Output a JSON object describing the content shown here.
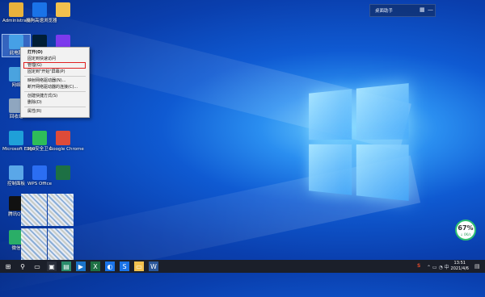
{
  "desktop": {
    "icons": [
      {
        "label": "Administrator",
        "icon": "user-folder-icon",
        "color": "#e8b23c"
      },
      {
        "label": "搜狗高速浏览器",
        "icon": "sogou-browser-icon",
        "color": "#1a73e8"
      },
      {
        "label": "",
        "icon": "folder-icon",
        "color": "#f2c14e"
      },
      {
        "label": "此电脑",
        "icon": "this-pc-icon",
        "color": "#46a0e6"
      },
      {
        "label": "",
        "icon": "photoshop-icon",
        "color": "#001e36"
      },
      {
        "label": "",
        "icon": "app-icon",
        "color": "#7c3aed"
      },
      {
        "label": "网络",
        "icon": "network-icon",
        "color": "#4aa3df"
      },
      {
        "label": "回收站",
        "icon": "recycle-bin-icon",
        "color": "#8fa6bf"
      },
      {
        "label": "Microsoft Edge",
        "icon": "edge-icon",
        "color": "#1fa0d8"
      },
      {
        "label": "360安全卫士",
        "icon": "security-app-icon",
        "color": "#2ebd59"
      },
      {
        "label": "Google Chrome",
        "icon": "chrome-icon",
        "color": "#dd4b39"
      },
      {
        "label": "控制面板",
        "icon": "control-panel-icon",
        "color": "#5aa7e8"
      },
      {
        "label": "WPS Office",
        "icon": "wps-icon",
        "color": "#2b6ef2"
      },
      {
        "label": "",
        "icon": "excel-icon",
        "color": "#1d7044"
      },
      {
        "label": "腾讯QQ",
        "icon": "qq-icon",
        "color": "#111111"
      },
      {
        "label": "微信",
        "icon": "wechat-icon",
        "color": "#2aae67"
      }
    ]
  },
  "context_menu": {
    "items": [
      {
        "label": "打开(O)",
        "bold": true
      },
      {
        "label": "固定到快速访问"
      },
      {
        "label": "管理(G)",
        "highlighted": true
      },
      {
        "label": "固定到\"开始\"屏幕(P)"
      },
      {
        "sep": true
      },
      {
        "label": "映射网络驱动器(N)..."
      },
      {
        "label": "断开网络驱动器的连接(C)..."
      },
      {
        "sep": true
      },
      {
        "label": "创建快捷方式(S)"
      },
      {
        "label": "删除(D)"
      },
      {
        "sep": true
      },
      {
        "label": "属性(R)"
      }
    ]
  },
  "widget": {
    "title": "桌面助手",
    "grid_symbol": "▦",
    "minimize_symbol": "—"
  },
  "net_meter": {
    "percent": "67%",
    "speed": "↓ 0K/s"
  },
  "taskbar": {
    "start_symbol": "⊞",
    "search_symbol": "⚲",
    "taskview_symbol": "▭",
    "apps": [
      {
        "icon": "terminal-icon",
        "color": "#2a2f3b",
        "char": "▣"
      },
      {
        "icon": "photos-icon",
        "color": "#2a8b6b",
        "char": "▤"
      },
      {
        "icon": "media-icon",
        "color": "#1b74c9",
        "char": "▶"
      },
      {
        "icon": "excel-icon",
        "color": "#1d7044",
        "char": "X"
      },
      {
        "icon": "browser-icon",
        "color": "#1a73e8",
        "char": "◐"
      },
      {
        "icon": "sogou-icon",
        "color": "#1a73e8",
        "char": "S"
      },
      {
        "icon": "explorer-icon",
        "color": "#f2c14e",
        "char": "▭"
      },
      {
        "icon": "word-icon",
        "color": "#2b579a",
        "char": "W"
      }
    ],
    "tray": {
      "ime": "S",
      "symbols": "⌃ ▭ ◔ 中"
    },
    "time": "13:51",
    "date": "2021/4/6",
    "notification": "▤"
  }
}
